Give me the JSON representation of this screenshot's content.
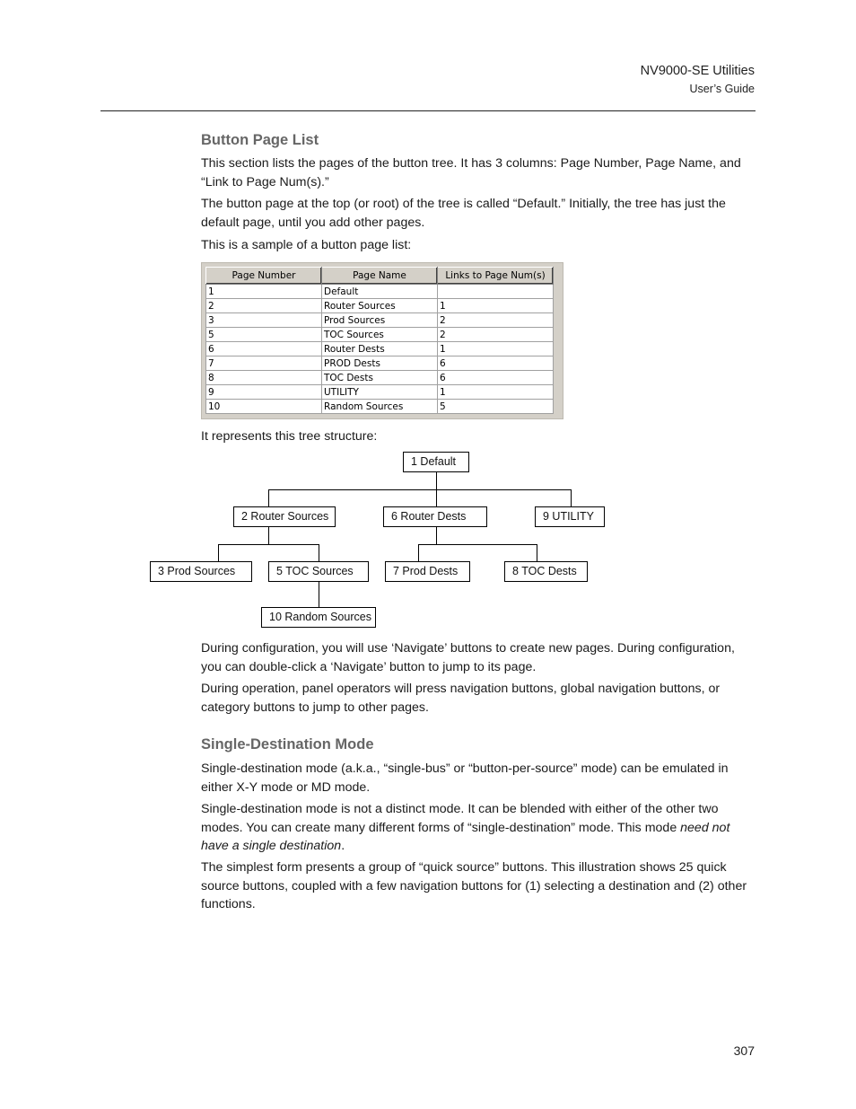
{
  "header": {
    "title": "NV9000-SE Utilities",
    "subtitle": "User’s Guide"
  },
  "section1": {
    "heading": "Button Page List",
    "paragraphs": [
      "This section lists the pages of the button tree. It has 3 columns: Page Number, Page Name, and “Link to Page Num(s).”",
      "The button page at the top (or root) of the tree is called “Default.” Initially, the tree has just the default page, until you add other pages.",
      "This is a sample of a button page list:"
    ],
    "table": {
      "columns": [
        "Page Number",
        "Page Name",
        "Links to Page Num(s)"
      ],
      "rows": [
        [
          "1",
          "Default",
          ""
        ],
        [
          "2",
          "Router Sources",
          "1"
        ],
        [
          "3",
          "Prod Sources",
          "2"
        ],
        [
          "5",
          "TOC Sources",
          "2"
        ],
        [
          "6",
          "Router Dests",
          "1"
        ],
        [
          "7",
          "PROD Dests",
          "6"
        ],
        [
          "8",
          "TOC Dests",
          "6"
        ],
        [
          "9",
          "UTILITY",
          "1"
        ],
        [
          "10",
          "Random Sources",
          "5"
        ]
      ]
    },
    "tree_intro": "It represents this tree structure:",
    "tree": {
      "nodes": {
        "n1": "1 Default",
        "n2": "2 Router Sources",
        "n6": "6 Router Dests",
        "n9": "9 UTILITY",
        "n3": "3 Prod Sources",
        "n5": "5 TOC Sources",
        "n7": "7 Prod Dests",
        "n8": "8 TOC Dests",
        "n10": "10 Random Sources"
      }
    },
    "after": [
      "During configuration, you will use ‘Navigate’ buttons to create new pages. During configuration, you can double-click a ‘Navigate’ button to jump to its page.",
      "During operation, panel operators will press navigation buttons, global navigation buttons, or category buttons to jump to other pages."
    ]
  },
  "section2": {
    "heading": "Single-Destination Mode",
    "p1": "Single-destination mode (a.k.a., “single-bus” or “button-per-source” mode) can be emulated in either X-Y mode or MD mode.",
    "p2_start": "Single-destination mode is not a distinct mode. It can be blended with either of the other two modes. You can create many different forms of “single-destination” mode. This mode ",
    "p2_italic": "need not have a single destination",
    "p2_end": ".",
    "p3": "The simplest form presents a group of “quick source” buttons. This illustration shows 25 quick source buttons, coupled with a few navigation buttons for (1) selecting a destination and (2) other functions."
  },
  "footer": {
    "page_number": "307"
  }
}
